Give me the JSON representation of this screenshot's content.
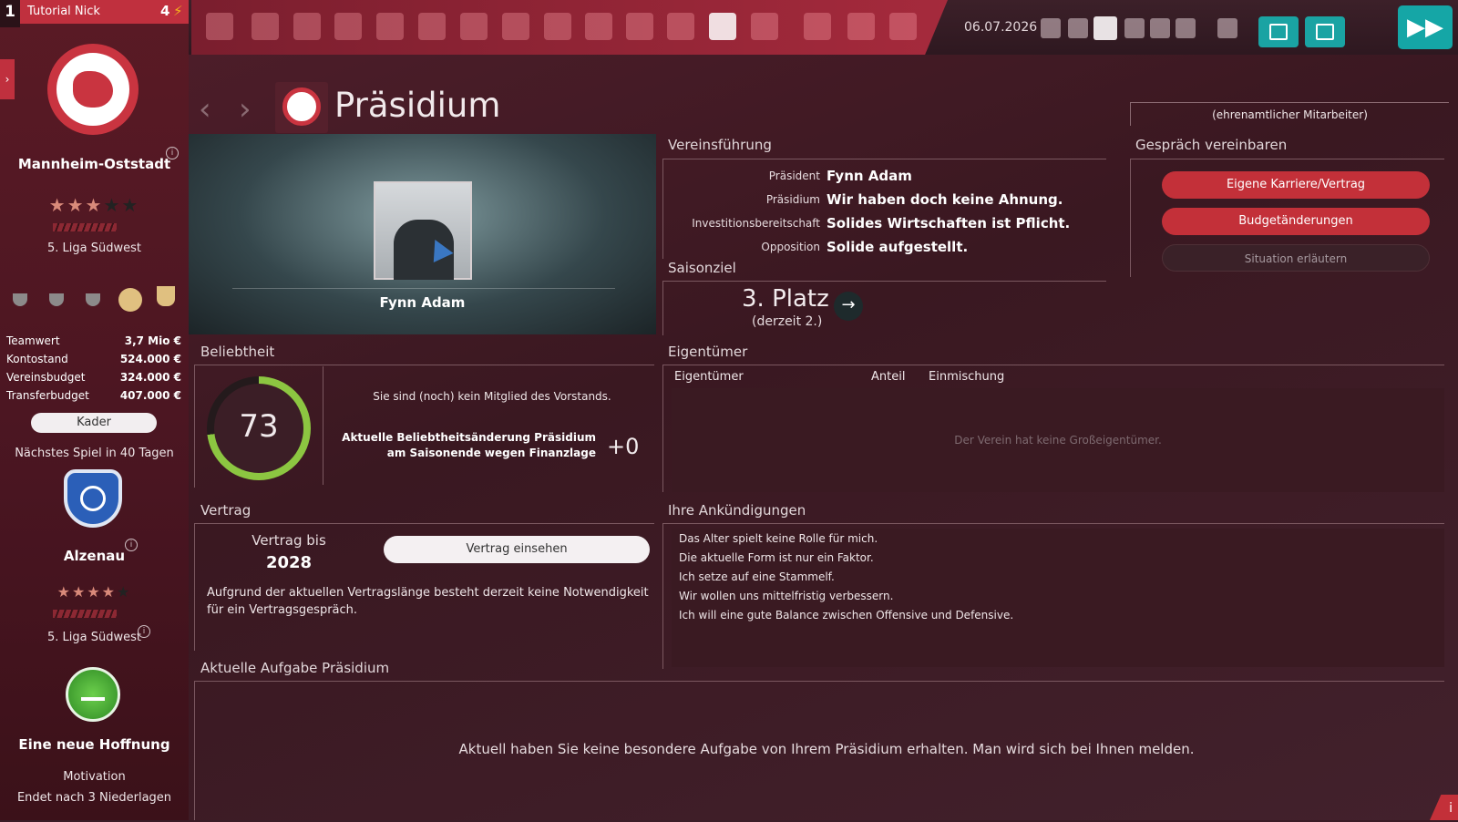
{
  "manager": {
    "slot": "1",
    "name": "Tutorial Nick",
    "badge": "4"
  },
  "date": "06.07.2026",
  "club": {
    "name": "Mannheim-Oststadt",
    "league": "5. Liga Südwest",
    "stars": 3,
    "finances": [
      {
        "label": "Teamwert",
        "value": "3,7 Mio €"
      },
      {
        "label": "Kontostand",
        "value": "524.000 €"
      },
      {
        "label": "Vereinsbudget",
        "value": "324.000 €"
      },
      {
        "label": "Transferbudget",
        "value": "407.000 €"
      }
    ],
    "squad_button": "Kader"
  },
  "next_match": {
    "label": "Nächstes Spiel in 40 Tagen",
    "opponent": "Alzenau",
    "stars": 4.5,
    "league": "5. Liga Südwest"
  },
  "motivation": {
    "title": "Eine neue Hoffnung",
    "label": "Motivation",
    "note": "Endet nach 3 Niederlagen"
  },
  "page": {
    "title": "Präsidium",
    "staff_tab": "(ehrenamtlicher Mitarbeiter)"
  },
  "president": {
    "name": "Fynn Adam"
  },
  "leadership": {
    "title": "Vereinsführung",
    "rows": [
      {
        "label": "Präsident",
        "value": "Fynn Adam"
      },
      {
        "label": "Präsidium",
        "value": "Wir haben doch keine Ahnung."
      },
      {
        "label": "Investitionsbereitschaft",
        "value": "Solides Wirtschaften ist Pflicht."
      },
      {
        "label": "Opposition",
        "value": "Solide aufgestellt."
      }
    ]
  },
  "meeting": {
    "title": "Gespräch vereinbaren",
    "buttons": [
      "Eigene Karriere/Vertrag",
      "Budgetänderungen",
      "Situation erläutern"
    ]
  },
  "season_goal": {
    "title": "Saisonziel",
    "goal": "3. Platz",
    "current": "(derzeit 2.)"
  },
  "popularity": {
    "title": "Beliebtheit",
    "value": "73",
    "fraction": 0.73,
    "not_member": "Sie sind (noch) kein Mitglied des Vorstands.",
    "change_label": "Aktuelle Beliebtheitsänderung Präsidium am Saisonende wegen Finanzlage",
    "change_value": "+0"
  },
  "owners": {
    "title": "Eigentümer",
    "columns": [
      "Eigentümer",
      "Anteil",
      "Einmischung"
    ],
    "empty": "Der Verein hat keine Großeigentümer."
  },
  "contract": {
    "title": "Vertrag",
    "label": "Vertrag bis",
    "year": "2028",
    "button": "Vertrag einsehen",
    "note": "Aufgrund der aktuellen Vertragslänge besteht derzeit keine Notwendigkeit für ein Vertragsgespräch."
  },
  "announcements": {
    "title": "Ihre Ankündigungen",
    "items": [
      "Das Alter spielt keine Rolle für mich.",
      "Die aktuelle Form ist nur ein Faktor.",
      "Ich setze auf eine Stammelf.",
      "Wir wollen uns mittelfristig verbessern.",
      "Ich will eine gute Balance zwischen Offensive und Defensive."
    ]
  },
  "task": {
    "title": "Aktuelle Aufgabe Präsidium",
    "text": "Aktuell haben Sie keine besondere Aufgabe von Ihrem Präsidium erhalten. Man wird sich bei Ihnen melden."
  },
  "colors": {
    "accent_red": "#c33039",
    "teal": "#15a6a6",
    "ring_green": "#8cc641"
  }
}
